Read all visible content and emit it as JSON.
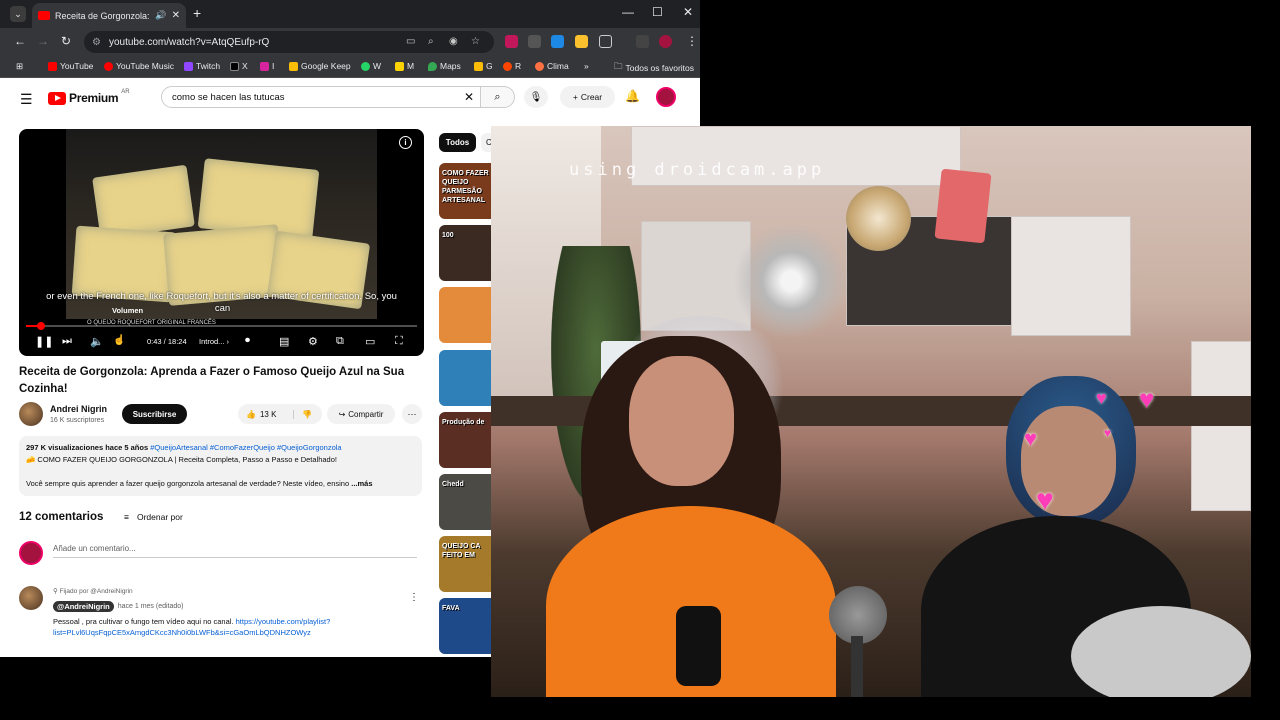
{
  "browser": {
    "tab_title": "Receita de Gorgonzola: Ap",
    "url": "youtube.com/watch?v=AtqQEufp-rQ",
    "bookmarks": [
      "YouTube",
      "YouTube Music",
      "Twitch",
      "X",
      "I",
      "Google Keep",
      "W",
      "M",
      "Maps",
      "G",
      "R",
      "Clima"
    ],
    "all_bookmarks": "Todos os favoritos"
  },
  "youtube": {
    "logo_text": "Premium",
    "logo_region": "AR",
    "search_query": "como se hacen las tutucas",
    "create_label": "Crear",
    "player": {
      "caption_line1": "or even the French one, like Roquefort, but it's also a matter of certification. So, you",
      "caption_line2": "can",
      "volume_tooltip": "Volumen",
      "chapter_tooltip": "O QUEIJO ROQUEFORT ORIGINAL FRANCÊS",
      "time": "0:43 / 18:24",
      "chapter": "Introd...",
      "progress_fraction": 0.039
    },
    "video_title": "Receita de Gorgonzola: Aprenda a Fazer o Famoso Queijo Azul na Sua Cozinha!",
    "channel_name": "Andrei Nigrin",
    "channel_subs": "16 K suscriptores",
    "subscribe_label": "Suscribirse",
    "likes": "13 K",
    "share_label": "Compartir",
    "description": {
      "meta": "297 K visualizaciones  hace 5 años",
      "tags": "#QueijoArtesanal #ComoFazerQueijo #QueijoGorgonzola",
      "line2": "🧀 COMO FAZER QUEIJO GORGONZOLA | Receita Completa, Passo a Passo e Detalhado!",
      "line3": "Você sempre quis aprender a fazer queijo gorgonzola artesanal de verdade? Neste vídeo, ensino",
      "more": "...más"
    },
    "comments_count": "12 comentarios",
    "sort_label": "Ordenar por",
    "add_comment_placeholder": "Añade un comentario...",
    "pinned_label": "Fijado por @AndreiNigrin",
    "comment_author": "@AndreiNigrin",
    "comment_time": "hace 1 mes (editado)",
    "comment_text": "Pessoal , pra cultivar o fungo tem vídeo aqui no canal. ",
    "comment_link": "https://youtube.com/playlist?list=PLvl6UqsFqpCE5xAmgdCKcc3Nh0i0bLWFb&si=cGaOmLbQDNHZOWyz",
    "chip_all": "Todos",
    "thumbs": [
      {
        "label": "COMO FAZER QUEIJO PARMESÃO ARTESANAL",
        "color": "#7a3b1d"
      },
      {
        "label": "100",
        "color": "#3b2a22"
      },
      {
        "label": "",
        "color": "#e48b3b"
      },
      {
        "label": "",
        "color": "#2f7fb8"
      },
      {
        "label": "Produção de",
        "color": "#5a2e22"
      },
      {
        "label": "Chedd",
        "color": "#4c4a44"
      },
      {
        "label": "QUEIJO CA FEITO EM",
        "color": "#a57a2a"
      },
      {
        "label": "FAVA",
        "color": "#1f4a8a"
      }
    ]
  },
  "camera": {
    "watermark": "using droidcam.app"
  }
}
